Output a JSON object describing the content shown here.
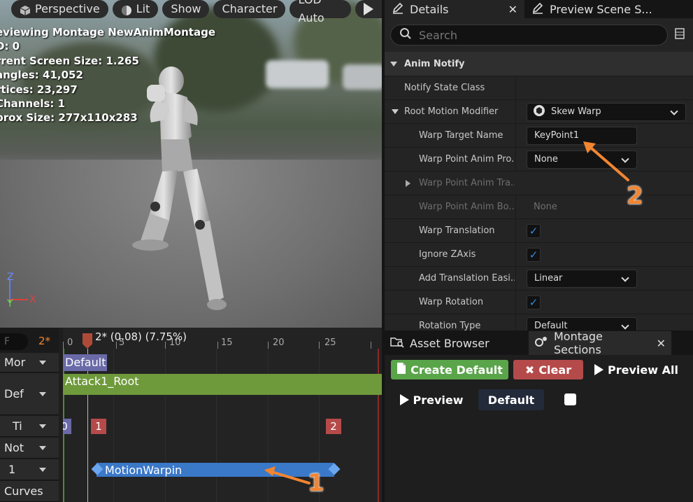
{
  "viewport": {
    "toolbar": [
      {
        "label": "Perspective",
        "icon": "cube-icon"
      },
      {
        "label": "Lit",
        "icon": "sphere-icon"
      },
      {
        "label": "Show"
      },
      {
        "label": "Character"
      },
      {
        "label": "LOD Auto"
      }
    ],
    "stats": [
      "eviewing Montage NewAnimMontage",
      "D: 0",
      "rrent Screen Size: 1.265",
      "angles: 41,052",
      "rtices: 23,297",
      " Channels: 1",
      "prox Size: 277x110x283"
    ],
    "axis": {
      "z": "Z",
      "y": "Y",
      "x": "X"
    }
  },
  "timeline": {
    "frame_input": "F",
    "frame_marker": "2*",
    "playhead_label": "2* (0.08) (7.75%)",
    "ticks": [
      "0",
      "5",
      "10",
      "15",
      "20",
      "25"
    ],
    "rows": [
      {
        "label": "Mor"
      },
      {
        "label": "Def"
      },
      {
        "label": "Ti"
      },
      {
        "label": "Not"
      },
      {
        "label": "1"
      },
      {
        "label": "Curves"
      }
    ],
    "section_default": "Default",
    "slot_clip": "Attack1_Root",
    "timing_markers": [
      "0",
      "1",
      "2"
    ],
    "notify_state": "MotionWarping"
  },
  "details": {
    "tabs": [
      {
        "label": "Details",
        "icon": "pencil-icon"
      },
      {
        "label": "Preview Scene S..."
      }
    ],
    "search_placeholder": "Search",
    "category": "Anim Notify",
    "properties": [
      {
        "name": "Notify State Class",
        "value": ""
      },
      {
        "name": "Root Motion Modifier",
        "value": "Skew Warp"
      },
      {
        "name": "Warp Target Name",
        "value": "KeyPoint1"
      },
      {
        "name": "Warp Point Anim Pro...",
        "value": "None"
      },
      {
        "name": "Warp Point Anim Tra...",
        "value": ""
      },
      {
        "name": "Warp Point Anim Bo...",
        "value": "None"
      },
      {
        "name": "Warp Translation",
        "value": "checked"
      },
      {
        "name": "Ignore ZAxis",
        "value": "checked"
      },
      {
        "name": "Add Translation Easi...",
        "value": "Linear"
      },
      {
        "name": "Warp Rotation",
        "value": "checked"
      },
      {
        "name": "Rotation Type",
        "value": "Default"
      }
    ]
  },
  "montage": {
    "tabs": [
      {
        "label": "Asset Browser"
      },
      {
        "label": "Montage Sections"
      }
    ],
    "create_default": "Create Default",
    "clear": "Clear",
    "preview_all": "Preview All",
    "preview": "Preview",
    "section_name": "Default"
  },
  "annotations": [
    "1",
    "2"
  ],
  "colors": {
    "accent_orange": "#f28530",
    "create_green": "#5aa54a",
    "clear_red": "#b54a4a",
    "notify_blue": "#3a78c8",
    "slot_green": "#6f9a3c",
    "section_purple": "#6a6aa8",
    "check_blue": "#2f8ae8"
  }
}
